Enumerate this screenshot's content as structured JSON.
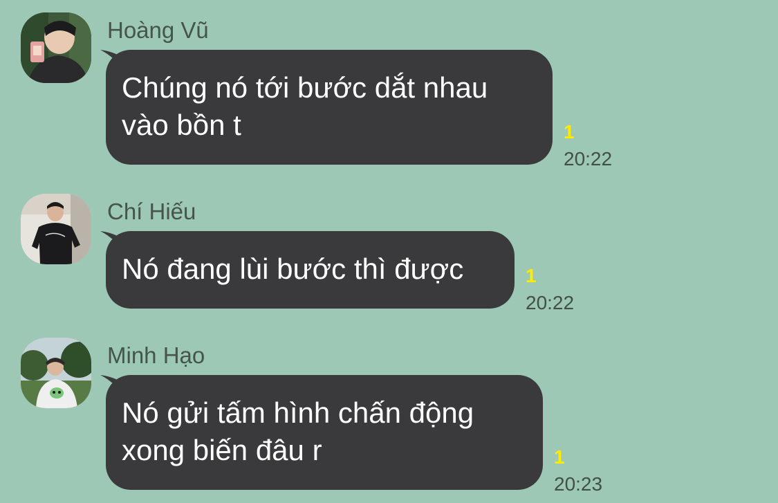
{
  "messages": [
    {
      "sender": "Hoàng Vũ",
      "text_line1": "Chúng nó tới bước dắt nhau",
      "text_line2": "vào bồn t",
      "unread": "1",
      "time": "20:22"
    },
    {
      "sender": "Chí Hiếu",
      "text_line1": "Nó đang lùi bước thì được",
      "unread": "1",
      "time": "20:22"
    },
    {
      "sender": "Minh Hạo",
      "text_line1": "Nó gửi tấm hình chấn động",
      "text_line2": "xong biến đâu r",
      "unread": "1",
      "time": "20:23"
    }
  ],
  "colors": {
    "background": "#9dc8b6",
    "bubble": "#3a3a3c",
    "bubble_text": "#ffffff",
    "unread": "#ffea00",
    "time": "#415047",
    "sender": "#45554c"
  },
  "icons": {
    "avatar_1": "user-photo-hoang-vu",
    "avatar_2": "user-photo-chi-hieu",
    "avatar_3": "user-photo-minh-hao"
  }
}
